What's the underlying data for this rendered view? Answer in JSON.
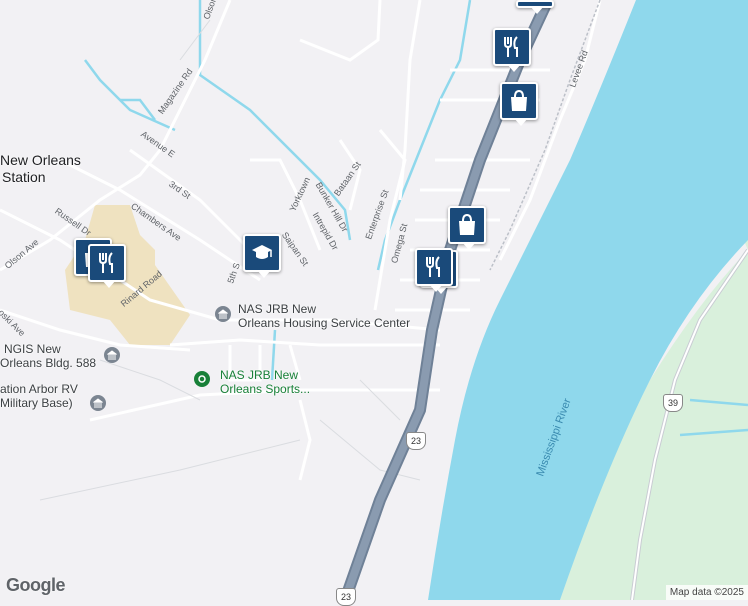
{
  "colors": {
    "land": "#f2f1f4",
    "water": "#8fd8ec",
    "park": "#d9f0dc",
    "campus": "#efe2c0",
    "highway": "#8a9bb0",
    "road": "#ffffff",
    "road_outline": "#c9ccd3",
    "pin": "#1a4a7a"
  },
  "places": {
    "station_line1": "New Orleans",
    "station_line2": "Station",
    "housing_line1": "NAS JRB New",
    "housing_line2": "Orleans Housing Service Center",
    "sports_line1": "NAS JRB New",
    "sports_line2": "Orleans Sports...",
    "ngis_line1": "NGIS New",
    "ngis_line2": "Orleans Bldg. 588",
    "rv_line1": "ation Arbor RV",
    "rv_line2": "Military Base)"
  },
  "streets": {
    "olson_top": "Olson",
    "magazine": "Magazine Rd",
    "avenue_e": "Avenue E",
    "third_st": "3rd St",
    "chambers": "Chambers Ave",
    "russell": "Russell Dr",
    "olson_ave": "Olson Ave",
    "rinard": "Rinard Road",
    "oski": "oski Ave",
    "fifth_st": "5th S",
    "yorktown": "Yorktown",
    "bunker_hill": "Bunker Hill Dr",
    "intrepid": "Intrepid Dr",
    "bataan": "Bataan St",
    "saipan": "Saipan St",
    "enterprise": "Enterprise St",
    "omega": "Omega St",
    "levee": "Levee Rd",
    "river": "Mississippi River"
  },
  "shields": {
    "route_23_a": "23",
    "route_23_b": "23",
    "route_39": "39"
  },
  "pins": [
    {
      "icon": "restaurant-icon"
    },
    {
      "icon": "shopping-bag-icon"
    },
    {
      "icon": "shopping-bag-icon"
    },
    {
      "icon": "restaurant-icon"
    },
    {
      "icon": "school-icon"
    },
    {
      "icon": "shopping-bag-icon"
    },
    {
      "icon": "restaurant-icon"
    },
    {
      "icon": "restaurant-icon"
    }
  ],
  "branding": {
    "logo": "Google",
    "attribution": "Map data ©2025"
  }
}
